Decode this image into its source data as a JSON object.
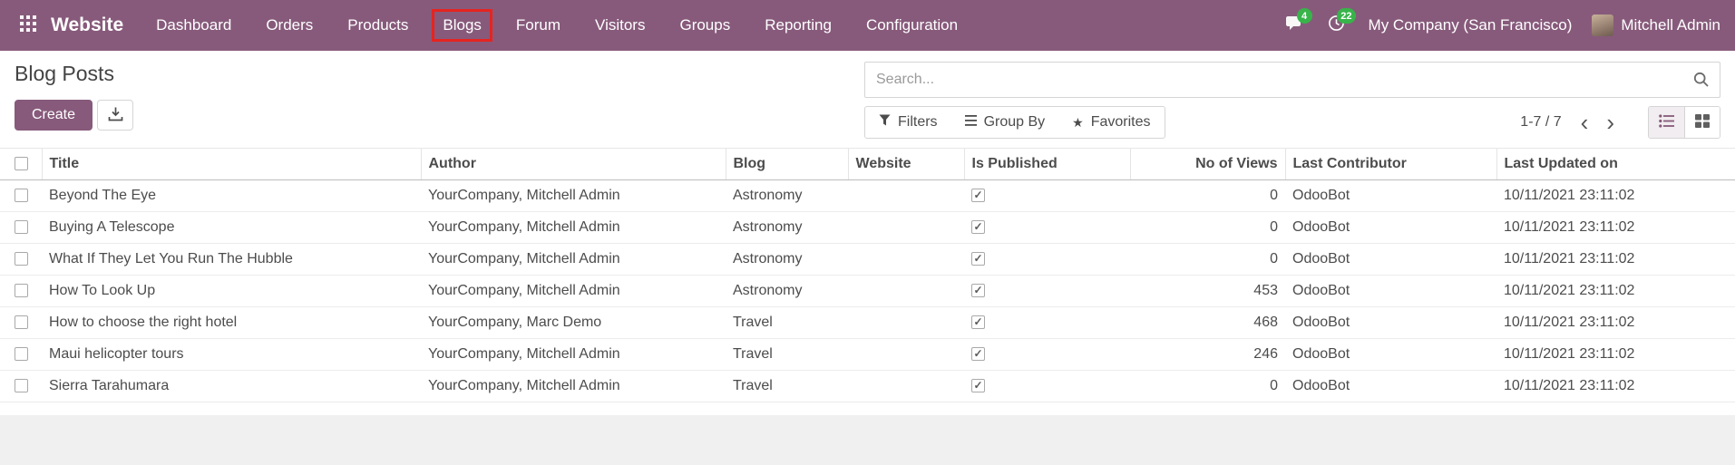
{
  "colors": {
    "navbar_bg": "#875A7B",
    "primary_button": "#875A7B",
    "badge_green": "#38b44a",
    "annotation_red": "#e52420",
    "active_view_icon": "#875A7B"
  },
  "navbar": {
    "brand": "Website",
    "menus": [
      "Dashboard",
      "Orders",
      "Products",
      "Blogs",
      "Forum",
      "Visitors",
      "Groups",
      "Reporting",
      "Configuration"
    ],
    "messages_count": "4",
    "activities_count": "22",
    "company": "My Company (San Francisco)",
    "user": "Mitchell Admin"
  },
  "page": {
    "title": "Blog Posts",
    "create_label": "Create",
    "search_placeholder": "Search...",
    "filters_label": "Filters",
    "group_by_label": "Group By",
    "favorites_label": "Favorites",
    "pager": "1-7 / 7"
  },
  "icons": {
    "star": "★",
    "check": "✓",
    "chevron_left": "‹",
    "chevron_right": "›",
    "kebab": "⋮"
  },
  "table": {
    "columns": [
      "Title",
      "Author",
      "Blog",
      "Website",
      "Is Published",
      "No of Views",
      "Last Contributor",
      "Last Updated on"
    ],
    "rows": [
      {
        "title": "Beyond The Eye",
        "author": "YourCompany, Mitchell Admin",
        "blog": "Astronomy",
        "website": "",
        "views": "0",
        "contributor": "OdooBot",
        "updated": "10/11/2021 23:11:02"
      },
      {
        "title": "Buying A Telescope",
        "author": "YourCompany, Mitchell Admin",
        "blog": "Astronomy",
        "website": "",
        "views": "0",
        "contributor": "OdooBot",
        "updated": "10/11/2021 23:11:02"
      },
      {
        "title": "What If They Let You Run The Hubble",
        "author": "YourCompany, Mitchell Admin",
        "blog": "Astronomy",
        "website": "",
        "views": "0",
        "contributor": "OdooBot",
        "updated": "10/11/2021 23:11:02"
      },
      {
        "title": "How To Look Up",
        "author": "YourCompany, Mitchell Admin",
        "blog": "Astronomy",
        "website": "",
        "views": "453",
        "contributor": "OdooBot",
        "updated": "10/11/2021 23:11:02"
      },
      {
        "title": "How to choose the right hotel",
        "author": "YourCompany, Marc Demo",
        "blog": "Travel",
        "website": "",
        "views": "468",
        "contributor": "OdooBot",
        "updated": "10/11/2021 23:11:02"
      },
      {
        "title": "Maui helicopter tours",
        "author": "YourCompany, Mitchell Admin",
        "blog": "Travel",
        "website": "",
        "views": "246",
        "contributor": "OdooBot",
        "updated": "10/11/2021 23:11:02"
      },
      {
        "title": "Sierra Tarahumara",
        "author": "YourCompany, Mitchell Admin",
        "blog": "Travel",
        "website": "",
        "views": "0",
        "contributor": "OdooBot",
        "updated": "10/11/2021 23:11:02"
      }
    ]
  }
}
